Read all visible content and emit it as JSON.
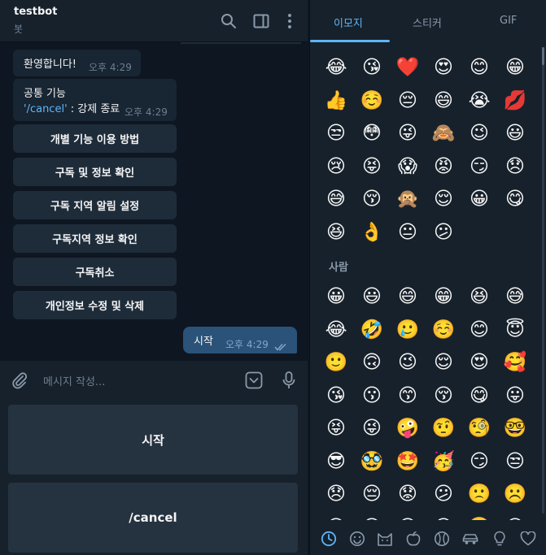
{
  "header": {
    "title": "testbot",
    "subtitle": "봇"
  },
  "messages": {
    "welcome": {
      "text": "환영합니다!",
      "time": "오후 4:29"
    },
    "common": {
      "line1": "공통 기능",
      "command": "'/cancel'",
      "line2_rest": " : 강제 종료",
      "time": "오후 4:29"
    },
    "inline_buttons": [
      "개별 기능 이용 방법",
      "구독 및 정보 확인",
      "구독 지역 알림 설정",
      "구독지역 정보 확인",
      "구독취소",
      "개인정보 수정 및 삭제"
    ],
    "outgoing": {
      "text": "시작",
      "time": "오후 4:29"
    }
  },
  "input": {
    "placeholder": "메시지 작성..."
  },
  "reply_keyboard": [
    "시작",
    "/cancel"
  ],
  "panel": {
    "tabs": [
      "이모지",
      "스티커",
      "GIF"
    ],
    "active_tab": "이모지",
    "recent_emoji": [
      [
        "😂",
        "😘",
        "❤️",
        "😍",
        "😊",
        "😁"
      ],
      [
        "👍",
        "☺️",
        "😔",
        "😄",
        "😭",
        "💋"
      ],
      [
        "😒",
        "😳",
        "😜",
        "🙈",
        "😉",
        "😃"
      ],
      [
        "😢",
        "😝",
        "😱",
        "😡",
        "😏",
        "😞"
      ],
      [
        "😅",
        "😚",
        "🙊",
        "😌",
        "😀",
        "😋"
      ],
      [
        "😆",
        "👌",
        "😐",
        "😕"
      ]
    ],
    "section_people": "사람",
    "people_emoji": [
      [
        "😀",
        "😃",
        "😄",
        "😁",
        "😆",
        "😅"
      ],
      [
        "😂",
        "🤣",
        "🥲",
        "☺️",
        "😊",
        "😇"
      ],
      [
        "🙂",
        "🙃",
        "😉",
        "😌",
        "😍",
        "🥰"
      ],
      [
        "😘",
        "😗",
        "😙",
        "😚",
        "😋",
        "😛"
      ],
      [
        "😝",
        "😜",
        "🤪",
        "🤨",
        "🧐",
        "🤓"
      ],
      [
        "😎",
        "🥸",
        "🤩",
        "🥳",
        "😏",
        "😒"
      ],
      [
        "😞",
        "😔",
        "😟",
        "😕",
        "🙁",
        "☹️"
      ],
      [
        "😣",
        "😖",
        "😫",
        "😩",
        "🥺",
        "😢"
      ]
    ],
    "accent_color": "#5eb5f7"
  }
}
